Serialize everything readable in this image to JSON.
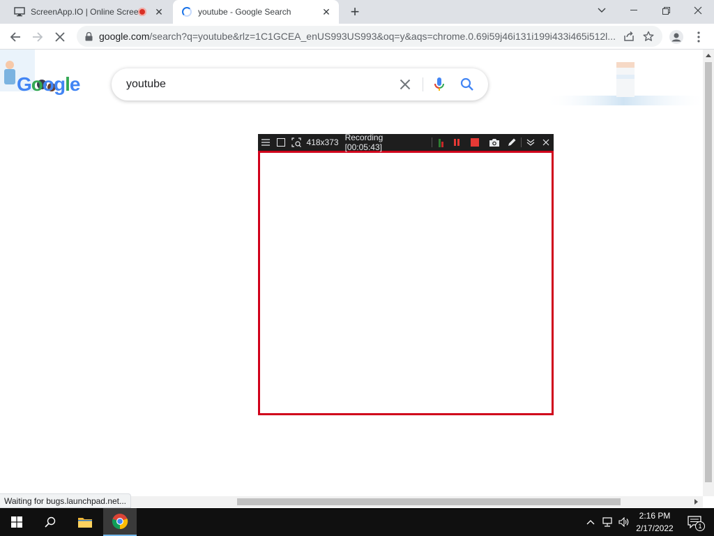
{
  "browser": {
    "tabs": [
      {
        "title": "ScreenApp.IO | Online Scree",
        "favicon": "monitor-icon",
        "recording": true
      },
      {
        "title": "youtube - Google Search",
        "favicon": "loading-spinner-icon",
        "active": true
      }
    ],
    "url_host": "google.com",
    "url_rest": "/search?q=youtube&rlz=1C1GCEA_enUS993US993&oq=y&aqs=chrome.0.69i59j46i131i199i433i465i512l...",
    "status_text": "Waiting for bugs.launchpad.net..."
  },
  "search": {
    "query": "youtube",
    "logo_text": "Google"
  },
  "recorder": {
    "dimensions": "418x373",
    "status": "Recording [00:05:43]",
    "frame_color": "#d0021b"
  },
  "taskbar": {
    "time": "2:16 PM",
    "date": "2/17/2022",
    "notification_count": "1"
  },
  "colors": {
    "google_blue": "#4285f4",
    "google_red": "#ea4335",
    "google_yellow": "#fbbc05",
    "google_green": "#34a853"
  }
}
